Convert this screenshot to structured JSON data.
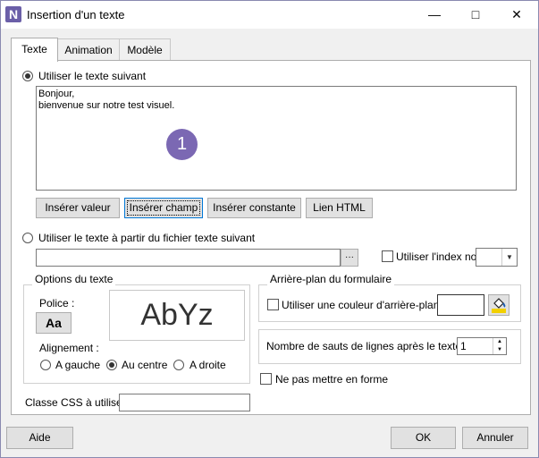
{
  "window": {
    "title": "Insertion d'un texte",
    "icon": "N"
  },
  "tabs": [
    {
      "label": "Texte"
    },
    {
      "label": "Animation"
    },
    {
      "label": "Modèle"
    }
  ],
  "text_source": {
    "option_text_label": "Utiliser le texte suivant",
    "text_content": "Bonjour,\nbienvenue sur notre test visuel.",
    "marker": "1",
    "buttons": {
      "insert_value": "Insérer valeur",
      "insert_field": "Insérer champ",
      "insert_constant": "Insérer constante",
      "html_link": "Lien HTML"
    },
    "option_file_label": "Utiliser le texte à partir du fichier texte suivant",
    "browse_label": "···",
    "use_index_label": "Utiliser l'index no"
  },
  "text_options": {
    "legend": "Options du texte",
    "font_label": "Police :",
    "font_button": "Aa",
    "preview": "AbYz",
    "alignment_label": "Alignement :",
    "align_left": "A gauche",
    "align_center": "Au centre",
    "align_right": "A droite",
    "selected_alignment": "Au centre"
  },
  "background": {
    "legend": "Arrière-plan du formulaire",
    "use_color_label": "Utiliser une couleur d'arrière-plan"
  },
  "line_breaks": {
    "label": "Nombre de sauts de lignes après le texte :",
    "value": "1"
  },
  "no_format_label": "Ne pas mettre en forme",
  "css_label": "Classe CSS à utiliser",
  "footer": {
    "help": "Aide",
    "ok": "OK",
    "cancel": "Annuler"
  },
  "colors": {
    "accent": "#7b68b3",
    "focus": "#0078d7"
  }
}
